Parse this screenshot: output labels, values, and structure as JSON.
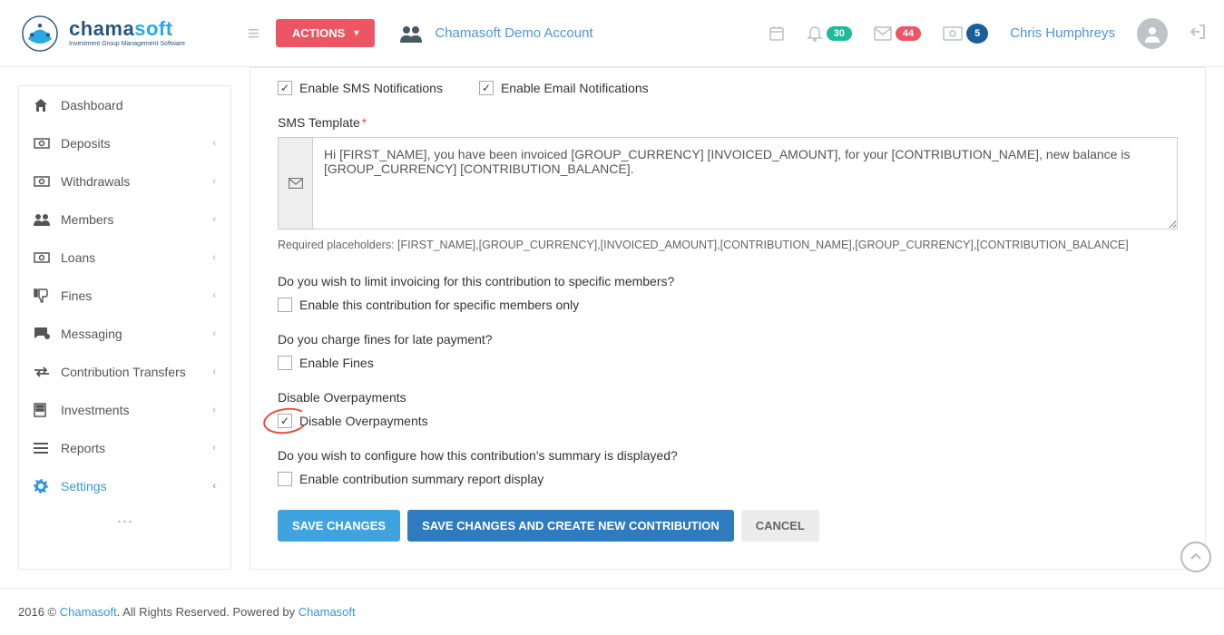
{
  "header": {
    "brand_main": "chama",
    "brand_soft": "soft",
    "brand_tag": "Investment Group Management Software",
    "actions_label": "ACTIONS",
    "account_name": "Chamasoft Demo Account",
    "notifications_count": "30",
    "messages_count": "44",
    "money_count": "5",
    "username": "Chris Humphreys"
  },
  "sidebar": {
    "items": [
      {
        "label": "Dashboard",
        "has_sub": false
      },
      {
        "label": "Deposits",
        "has_sub": true
      },
      {
        "label": "Withdrawals",
        "has_sub": true
      },
      {
        "label": "Members",
        "has_sub": true
      },
      {
        "label": "Loans",
        "has_sub": true
      },
      {
        "label": "Fines",
        "has_sub": true
      },
      {
        "label": "Messaging",
        "has_sub": true
      },
      {
        "label": "Contribution Transfers",
        "has_sub": true
      },
      {
        "label": "Investments",
        "has_sub": true
      },
      {
        "label": "Reports",
        "has_sub": true
      },
      {
        "label": "Settings",
        "has_sub": true
      }
    ]
  },
  "form": {
    "enable_sms_label": "Enable SMS Notifications",
    "enable_email_label": "Enable Email Notifications",
    "sms_template_label": "SMS Template",
    "sms_template_value": "Hi [FIRST_NAME], you have been invoiced [GROUP_CURRENCY] [INVOICED_AMOUNT], for your [CONTRIBUTION_NAME], new balance is [GROUP_CURRENCY] [CONTRIBUTION_BALANCE].",
    "placeholders_help": "Required placeholders: [FIRST_NAME],[GROUP_CURRENCY],[INVOICED_AMOUNT],[CONTRIBUTION_NAME],[GROUP_CURRENCY],[CONTRIBUTION_BALANCE]",
    "q_specific": "Do you wish to limit invoicing for this contribution to specific members?",
    "chk_specific": "Enable this contribution for specific members only",
    "q_fines": "Do you charge fines for late payment?",
    "chk_fines": "Enable Fines",
    "q_overpay": "Disable Overpayments",
    "chk_overpay": "Disable Overpayments",
    "q_summary": "Do you wish to configure how this contribution's summary is displayed?",
    "chk_summary": "Enable contribution summary report display",
    "btn_save": "SAVE CHANGES",
    "btn_save_new": "SAVE CHANGES AND CREATE NEW CONTRIBUTION",
    "btn_cancel": "CANCEL"
  },
  "footer": {
    "year": "2016 © ",
    "link1": "Chamasoft",
    "middle": ". All Rights Reserved. Powered by ",
    "link2": "Chamasoft"
  }
}
